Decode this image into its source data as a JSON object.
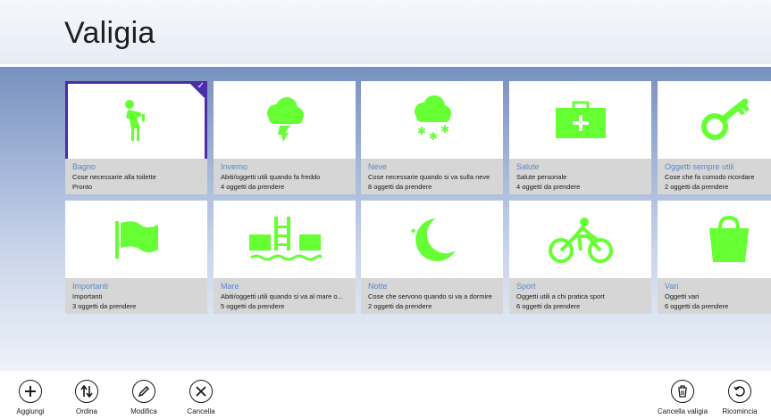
{
  "app": {
    "title": "Valigia"
  },
  "colors": {
    "accent": "#4b2ea6",
    "icon": "#66ff33",
    "tile_title": "#5b87c5"
  },
  "tiles": [
    {
      "title": "Bagno",
      "desc": "Cose necessarie alla toilette",
      "status": "Pronto",
      "icon": "toilet-person-icon",
      "selected": true
    },
    {
      "title": "Inverno",
      "desc": "Abiti/oggetti utili quando fa freddo",
      "status": "4 oggetti da prendere",
      "icon": "storm-cloud-icon"
    },
    {
      "title": "Neve",
      "desc": "Cose necessarie quando si va sulla neve",
      "status": "8 oggetti da prendere",
      "icon": "snow-cloud-icon"
    },
    {
      "title": "Salute",
      "desc": "Salute personale",
      "status": "4 oggetti da prendere",
      "icon": "first-aid-kit-icon"
    },
    {
      "title": "Oggetti sempre utili",
      "desc": "Cose che fa comodo ricordare",
      "status": "2 oggetti da prendere",
      "icon": "key-icon"
    },
    {
      "title": "Importanti",
      "desc": "Importanti",
      "status": "3 oggetti da prendere",
      "icon": "flag-icon"
    },
    {
      "title": "Mare",
      "desc": "Abiti/oggetti utili quando si va al mare o...",
      "status": "5 oggetti da prendere",
      "icon": "pool-ladder-icon"
    },
    {
      "title": "Notte",
      "desc": "Cose che servono quando si va a dormire",
      "status": "2 oggetti da prendere",
      "icon": "moon-stars-icon"
    },
    {
      "title": "Sport",
      "desc": "Oggetti utili a chi pratica sport",
      "status": "6 oggetti da prendere",
      "icon": "cyclist-icon"
    },
    {
      "title": "Vari",
      "desc": "Oggetti vari",
      "status": "6 oggetti da prendere",
      "icon": "shopping-bag-icon"
    }
  ],
  "appbar": {
    "left": [
      {
        "label": "Aggiungi",
        "icon": "plus-icon"
      },
      {
        "label": "Ordina",
        "icon": "sort-arrows-icon"
      },
      {
        "label": "Modifica",
        "icon": "pencil-icon"
      },
      {
        "label": "Cancella",
        "icon": "x-icon"
      }
    ],
    "right": [
      {
        "label": "Cancella valigia",
        "icon": "trash-icon"
      },
      {
        "label": "Ricomincia",
        "icon": "restart-icon"
      }
    ]
  }
}
